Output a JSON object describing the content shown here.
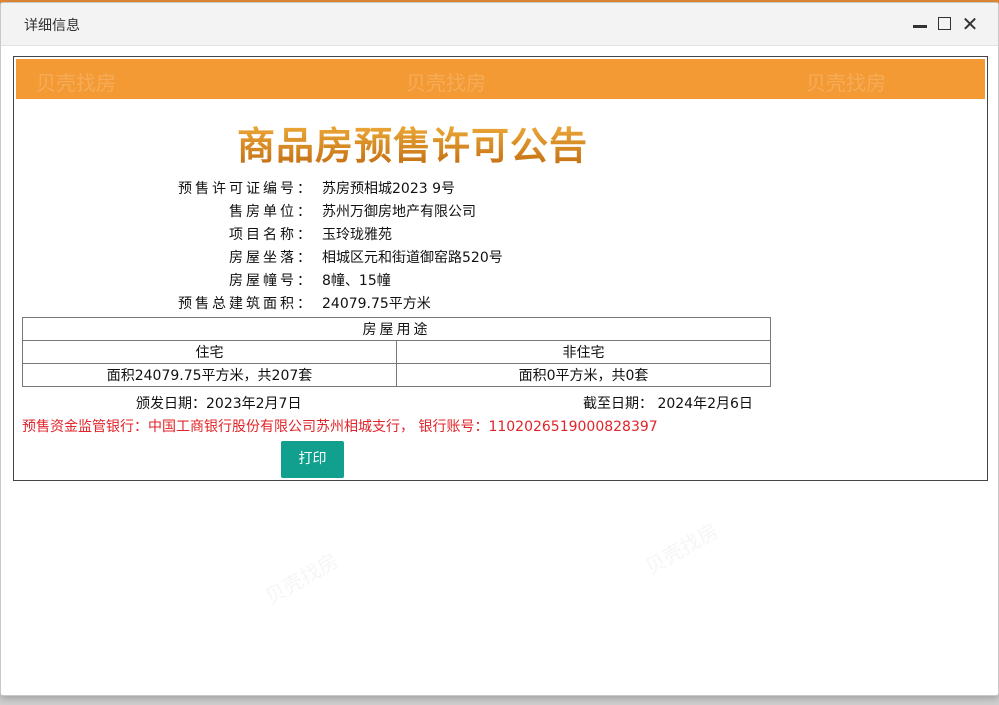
{
  "window": {
    "title": "详细信息"
  },
  "heading": "商品房预售许可公告",
  "info": [
    {
      "label": "预售许可证编号：",
      "value": "苏房预相城2023 9号"
    },
    {
      "label": "售房单位：",
      "value": "苏州万御房地产有限公司"
    },
    {
      "label": "项目名称：",
      "value": "玉玲珑雅苑"
    },
    {
      "label": "房屋坐落：",
      "value": "相城区元和街道御窑路520号"
    },
    {
      "label": "房屋幢号：",
      "value": "8幢、15幢"
    },
    {
      "label": "预售总建筑面积：",
      "value": "24079.75平方米"
    }
  ],
  "usage_table": {
    "title": "房屋用途",
    "headers": [
      "住宅",
      "非住宅"
    ],
    "values": [
      "面积24079.75平方米，共207套",
      "面积0平方米，共0套"
    ]
  },
  "dates": {
    "issue_label": "颁发日期：",
    "issue_value": "2023年2月7日",
    "expire_label": "截至日期：",
    "expire_value": "2024年2月6日"
  },
  "bank_notice": "预售资金监管银行：中国工商银行股份有限公司苏州相城支行， 银行账号：1102026519000828397",
  "buttons": {
    "print": "打印"
  },
  "watermark": "贝壳找房",
  "colors": {
    "banner": "#f39a34",
    "print_button": "#12a08e",
    "notice_red": "#e0242a"
  }
}
